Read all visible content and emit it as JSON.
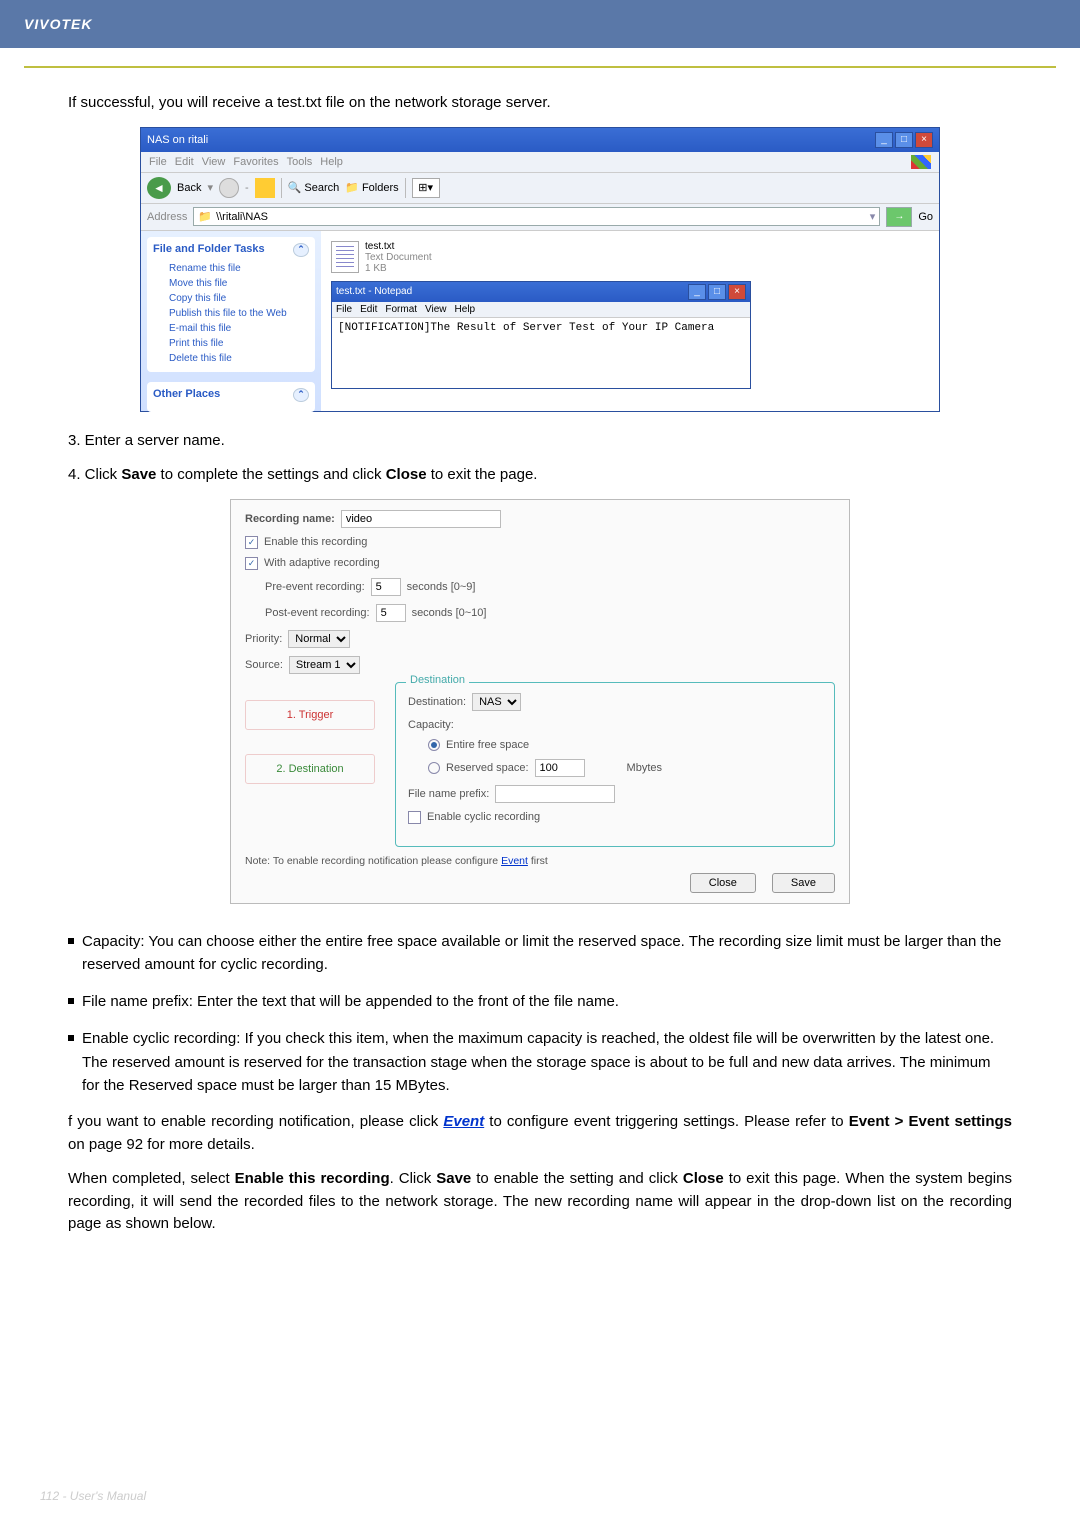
{
  "brand": "VIVOTEK",
  "intro": "If successful, you will receive a test.txt file on the network storage server.",
  "explorer": {
    "title": "NAS on ritali",
    "menu": [
      "File",
      "Edit",
      "View",
      "Favorites",
      "Tools",
      "Help"
    ],
    "back": "Back",
    "search": "Search",
    "folders": "Folders",
    "address_label": "Address",
    "address_value": "\\\\ritali\\NAS",
    "go": "Go",
    "side_title_1": "File and Folder Tasks",
    "side_items": [
      "Rename this file",
      "Move this file",
      "Copy this file",
      "Publish this file to the Web",
      "E-mail this file",
      "Print this file",
      "Delete this file"
    ],
    "side_title_2": "Other Places",
    "file": {
      "name": "test.txt",
      "type": "Text Document",
      "size": "1 KB"
    },
    "notepad": {
      "title": "test.txt - Notepad",
      "menu": [
        "File",
        "Edit",
        "Format",
        "View",
        "Help"
      ],
      "body": "[NOTIFICATION]The Result of Server Test of Your IP Camera"
    }
  },
  "steps": {
    "s3": "3. Enter a server name.",
    "s4a": "4. Click ",
    "s4_save": "Save",
    "s4b": " to complete the settings and click ",
    "s4_close": "Close",
    "s4c": " to exit the page."
  },
  "settings": {
    "rec_name_lbl": "Recording name:",
    "rec_name_val": "video",
    "enable": "Enable this recording",
    "adaptive": "With adaptive recording",
    "pre_lbl": "Pre-event recording:",
    "pre_val": "5",
    "pre_hint": "seconds [0~9]",
    "post_lbl": "Post-event recording:",
    "post_val": "5",
    "post_hint": "seconds [0~10]",
    "priority_lbl": "Priority:",
    "priority_val": "Normal",
    "source_lbl": "Source:",
    "source_val": "Stream 1",
    "step1": "1. Trigger",
    "step2": "2. Destination",
    "dest_legend": "Destination",
    "dest_lbl": "Destination:",
    "dest_val": "NAS",
    "capacity_lbl": "Capacity:",
    "entire": "Entire free space",
    "reserved": "Reserved space:",
    "reserved_val": "100",
    "mbytes": "Mbytes",
    "prefix_lbl": "File name prefix:",
    "cyclic": "Enable cyclic recording",
    "note_a": "Note: To enable recording notification please configure ",
    "note_link": "Event",
    "note_b": " first",
    "close": "Close",
    "save": "Save"
  },
  "bullets": {
    "b1": "Capacity: You can choose either the entire free space available or limit the reserved space. The recording size limit must be larger than the reserved amount for cyclic recording.",
    "b2": "File name prefix: Enter the text that will be appended to the front of the file name.",
    "b3": "Enable cyclic recording: If you check this item, when the maximum capacity is reached, the oldest file will be overwritten by the latest one. The reserved amount is reserved for the transaction stage when the storage space is about to be full and new data arrives. The minimum for the Reserved space must be larger than 15 MBytes."
  },
  "after": {
    "p1a": "f you want to enable recording notification, please click ",
    "p1_link": "Event",
    "p1b": " to configure event triggering settings. Please refer to ",
    "p1_bold": "Event > Event settings",
    "p1c": " on page 92 for more details.",
    "p2a": "When completed, select ",
    "p2_b1": "Enable this recording",
    "p2b": ". Click ",
    "p2_b2": "Save",
    "p2c": " to enable the setting and click ",
    "p2_b3": "Close",
    "p2d": " to exit this page. When the system begins recording, it will send the recorded files to the network storage. The new recording name will appear in the drop-down list on the recording page as shown below."
  },
  "footer": "112 - User's Manual"
}
